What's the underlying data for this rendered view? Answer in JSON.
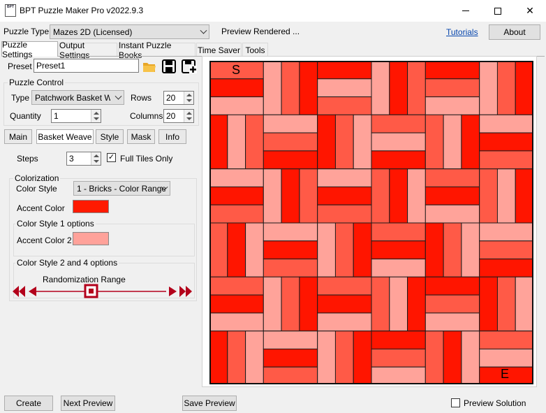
{
  "window": {
    "title": "BPT Puzzle Maker Pro v2022.9.3",
    "icon_text": "BPT",
    "minimize_icon": "minimize-icon",
    "maximize_icon": "maximize-icon",
    "close_icon": "close-icon"
  },
  "top": {
    "puzzle_type_label": "Puzzle Type",
    "puzzle_type_value": "Mazes 2D (Licensed)",
    "status": "Preview Rendered ...",
    "tutorials": "Tutorials",
    "about": "About"
  },
  "tabs": [
    "Puzzle Settings",
    "Output Settings",
    "Instant Puzzle Books",
    "Time Saver",
    "Tools"
  ],
  "preset": {
    "label": "Preset",
    "value": "Preset1"
  },
  "puzzle_control": {
    "legend": "Puzzle Control",
    "type_label": "Type",
    "type_value": "Patchwork Basket Weave",
    "rows_label": "Rows",
    "rows_value": "20",
    "quantity_label": "Quantity",
    "quantity_value": "1",
    "columns_label": "Columns",
    "columns_value": "20"
  },
  "subtabs": [
    "Main",
    "Basket Weave",
    "Style",
    "Mask",
    "Info"
  ],
  "steps": {
    "label": "Steps",
    "value": "3",
    "full_tiles_label": "Full Tiles Only",
    "full_tiles_checked": true
  },
  "colorization": {
    "legend": "Colorization",
    "color_style_label": "Color Style",
    "color_style_value": "1 - Bricks - Color Range",
    "accent_label": "Accent Color",
    "accent_color": "#ff1a00",
    "style1_legend": "Color Style 1 options",
    "accent2_label": "Accent Color 2",
    "accent2_color": "#ffa29a",
    "style24_legend": "Color Style 2 and 4 options",
    "randomization_label": "Randomization Range"
  },
  "maze": {
    "start": "S",
    "end": "E",
    "colors": {
      "dark": "#ff1500",
      "mid": "#ff5a47",
      "light": "#ffa39a"
    }
  },
  "bottom": {
    "create": "Create",
    "next_preview": "Next Preview",
    "save_preview": "Save Preview",
    "preview_solution": "Preview Solution",
    "preview_solution_checked": false
  }
}
